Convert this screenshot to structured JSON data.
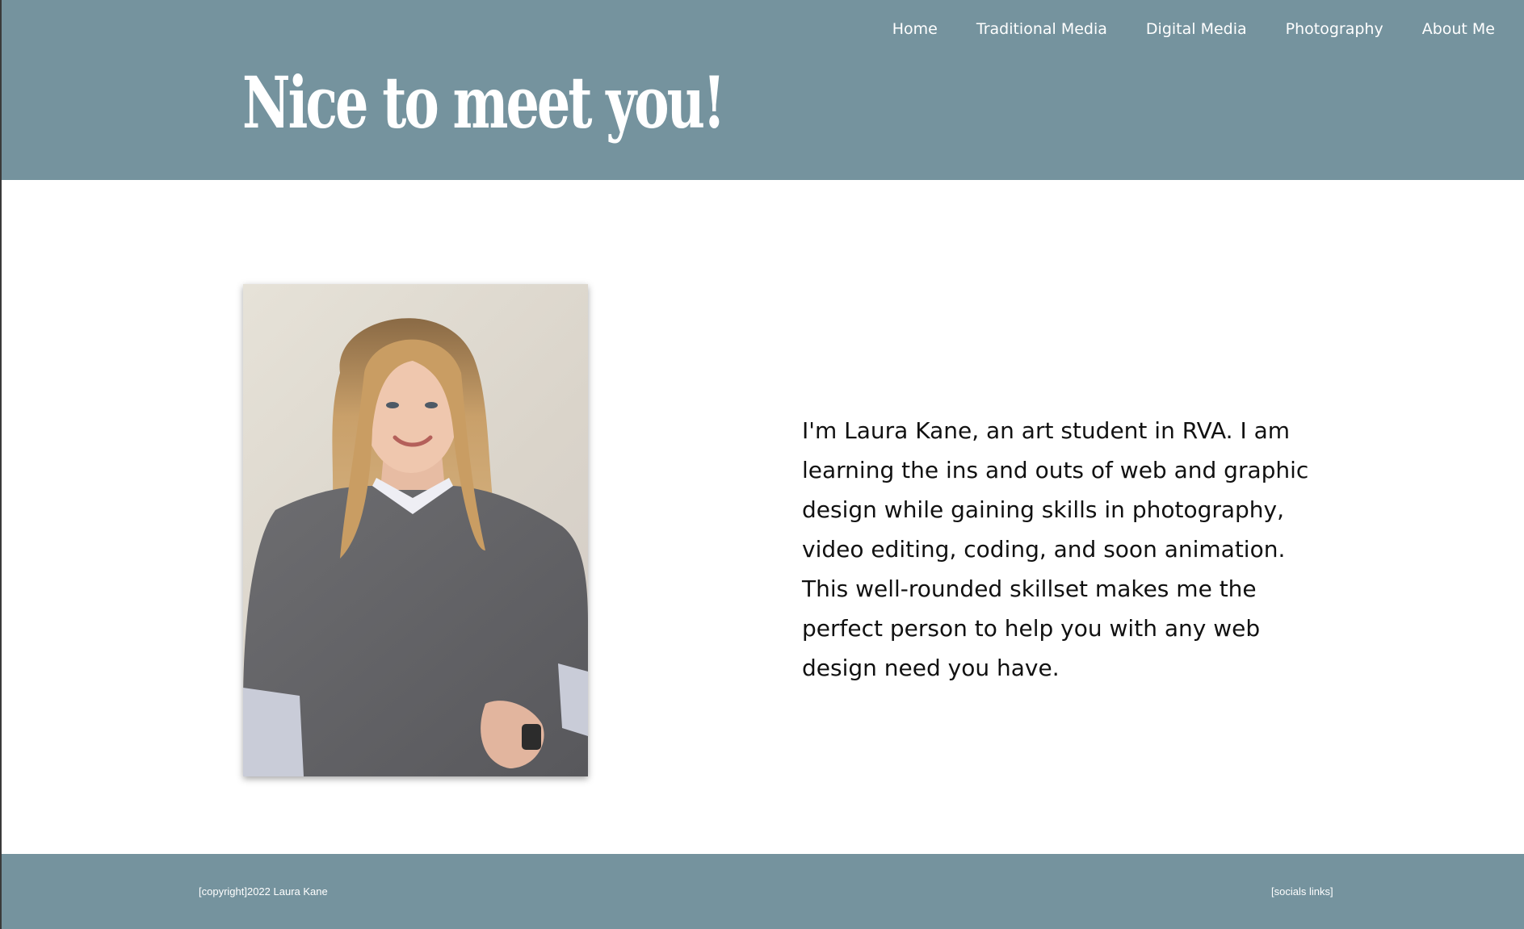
{
  "nav": {
    "items": [
      {
        "label": "Home"
      },
      {
        "label": "Traditional Media"
      },
      {
        "label": "Digital Media"
      },
      {
        "label": "Photography"
      },
      {
        "label": "About Me"
      }
    ]
  },
  "header": {
    "title": "Nice to meet you!"
  },
  "main": {
    "bio": "I'm Laura Kane, an art student in RVA. I am learning the ins and outs of web and graphic design while gaining skills in photography, video editing, coding, and soon animation. This well-rounded skillset makes me the perfect person to help you with any web design need you have."
  },
  "footer": {
    "copyright": "[copyright]2022 Laura Kane",
    "socials": "[socials links]"
  },
  "colors": {
    "header_bg": "#75939e",
    "footer_bg": "#75939e",
    "text_light": "#ffffff",
    "text_dark": "#111111"
  }
}
